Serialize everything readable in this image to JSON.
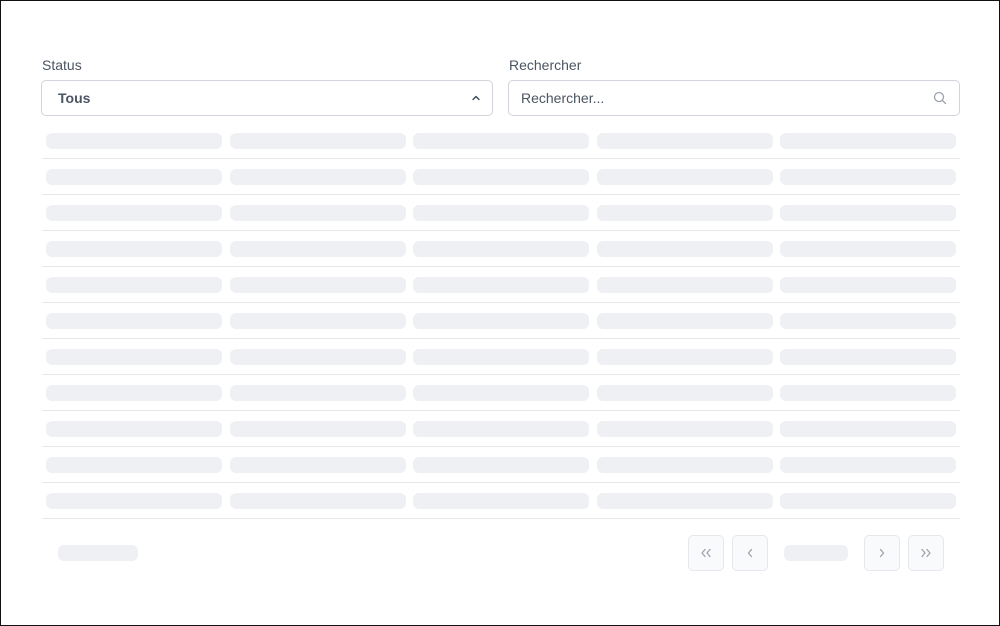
{
  "filters": {
    "status": {
      "label": "Status",
      "value": "Tous",
      "icon": "chevron-up-icon"
    },
    "search": {
      "label": "Rechercher",
      "placeholder": "Rechercher...",
      "value": "",
      "icon": "search-icon"
    }
  },
  "table": {
    "state": "loading",
    "skeleton_rows": 11,
    "skeleton_columns": 5
  },
  "pagination": {
    "icons": [
      "chevrons-left-icon",
      "chevron-left-icon",
      "chevron-right-icon",
      "chevrons-right-icon"
    ]
  },
  "colors": {
    "border": "#d1d5db",
    "skeleton": "#eef0f3",
    "divider": "#e5e7eb",
    "label_text": "#4b5563"
  }
}
